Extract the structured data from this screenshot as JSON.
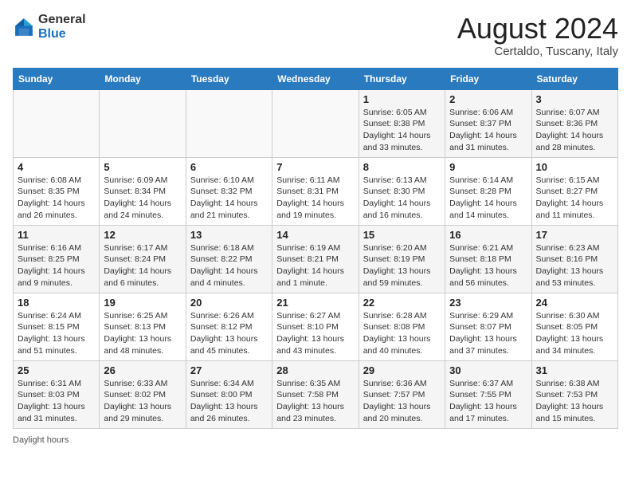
{
  "header": {
    "logo_general": "General",
    "logo_blue": "Blue",
    "month_title": "August 2024",
    "subtitle": "Certaldo, Tuscany, Italy"
  },
  "days_of_week": [
    "Sunday",
    "Monday",
    "Tuesday",
    "Wednesday",
    "Thursday",
    "Friday",
    "Saturday"
  ],
  "weeks": [
    [
      {
        "num": "",
        "info": ""
      },
      {
        "num": "",
        "info": ""
      },
      {
        "num": "",
        "info": ""
      },
      {
        "num": "",
        "info": ""
      },
      {
        "num": "1",
        "info": "Sunrise: 6:05 AM\nSunset: 8:38 PM\nDaylight: 14 hours\nand 33 minutes."
      },
      {
        "num": "2",
        "info": "Sunrise: 6:06 AM\nSunset: 8:37 PM\nDaylight: 14 hours\nand 31 minutes."
      },
      {
        "num": "3",
        "info": "Sunrise: 6:07 AM\nSunset: 8:36 PM\nDaylight: 14 hours\nand 28 minutes."
      }
    ],
    [
      {
        "num": "4",
        "info": "Sunrise: 6:08 AM\nSunset: 8:35 PM\nDaylight: 14 hours\nand 26 minutes."
      },
      {
        "num": "5",
        "info": "Sunrise: 6:09 AM\nSunset: 8:34 PM\nDaylight: 14 hours\nand 24 minutes."
      },
      {
        "num": "6",
        "info": "Sunrise: 6:10 AM\nSunset: 8:32 PM\nDaylight: 14 hours\nand 21 minutes."
      },
      {
        "num": "7",
        "info": "Sunrise: 6:11 AM\nSunset: 8:31 PM\nDaylight: 14 hours\nand 19 minutes."
      },
      {
        "num": "8",
        "info": "Sunrise: 6:13 AM\nSunset: 8:30 PM\nDaylight: 14 hours\nand 16 minutes."
      },
      {
        "num": "9",
        "info": "Sunrise: 6:14 AM\nSunset: 8:28 PM\nDaylight: 14 hours\nand 14 minutes."
      },
      {
        "num": "10",
        "info": "Sunrise: 6:15 AM\nSunset: 8:27 PM\nDaylight: 14 hours\nand 11 minutes."
      }
    ],
    [
      {
        "num": "11",
        "info": "Sunrise: 6:16 AM\nSunset: 8:25 PM\nDaylight: 14 hours\nand 9 minutes."
      },
      {
        "num": "12",
        "info": "Sunrise: 6:17 AM\nSunset: 8:24 PM\nDaylight: 14 hours\nand 6 minutes."
      },
      {
        "num": "13",
        "info": "Sunrise: 6:18 AM\nSunset: 8:22 PM\nDaylight: 14 hours\nand 4 minutes."
      },
      {
        "num": "14",
        "info": "Sunrise: 6:19 AM\nSunset: 8:21 PM\nDaylight: 14 hours\nand 1 minute."
      },
      {
        "num": "15",
        "info": "Sunrise: 6:20 AM\nSunset: 8:19 PM\nDaylight: 13 hours\nand 59 minutes."
      },
      {
        "num": "16",
        "info": "Sunrise: 6:21 AM\nSunset: 8:18 PM\nDaylight: 13 hours\nand 56 minutes."
      },
      {
        "num": "17",
        "info": "Sunrise: 6:23 AM\nSunset: 8:16 PM\nDaylight: 13 hours\nand 53 minutes."
      }
    ],
    [
      {
        "num": "18",
        "info": "Sunrise: 6:24 AM\nSunset: 8:15 PM\nDaylight: 13 hours\nand 51 minutes."
      },
      {
        "num": "19",
        "info": "Sunrise: 6:25 AM\nSunset: 8:13 PM\nDaylight: 13 hours\nand 48 minutes."
      },
      {
        "num": "20",
        "info": "Sunrise: 6:26 AM\nSunset: 8:12 PM\nDaylight: 13 hours\nand 45 minutes."
      },
      {
        "num": "21",
        "info": "Sunrise: 6:27 AM\nSunset: 8:10 PM\nDaylight: 13 hours\nand 43 minutes."
      },
      {
        "num": "22",
        "info": "Sunrise: 6:28 AM\nSunset: 8:08 PM\nDaylight: 13 hours\nand 40 minutes."
      },
      {
        "num": "23",
        "info": "Sunrise: 6:29 AM\nSunset: 8:07 PM\nDaylight: 13 hours\nand 37 minutes."
      },
      {
        "num": "24",
        "info": "Sunrise: 6:30 AM\nSunset: 8:05 PM\nDaylight: 13 hours\nand 34 minutes."
      }
    ],
    [
      {
        "num": "25",
        "info": "Sunrise: 6:31 AM\nSunset: 8:03 PM\nDaylight: 13 hours\nand 31 minutes."
      },
      {
        "num": "26",
        "info": "Sunrise: 6:33 AM\nSunset: 8:02 PM\nDaylight: 13 hours\nand 29 minutes."
      },
      {
        "num": "27",
        "info": "Sunrise: 6:34 AM\nSunset: 8:00 PM\nDaylight: 13 hours\nand 26 minutes."
      },
      {
        "num": "28",
        "info": "Sunrise: 6:35 AM\nSunset: 7:58 PM\nDaylight: 13 hours\nand 23 minutes."
      },
      {
        "num": "29",
        "info": "Sunrise: 6:36 AM\nSunset: 7:57 PM\nDaylight: 13 hours\nand 20 minutes."
      },
      {
        "num": "30",
        "info": "Sunrise: 6:37 AM\nSunset: 7:55 PM\nDaylight: 13 hours\nand 17 minutes."
      },
      {
        "num": "31",
        "info": "Sunrise: 6:38 AM\nSunset: 7:53 PM\nDaylight: 13 hours\nand 15 minutes."
      }
    ]
  ],
  "footer": {
    "daylight_label": "Daylight hours"
  }
}
